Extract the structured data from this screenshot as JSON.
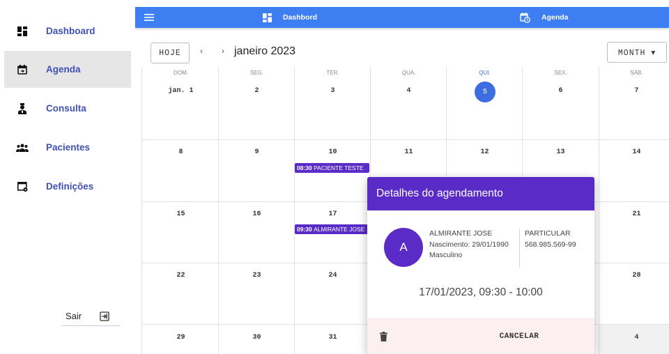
{
  "sidebar": {
    "items": [
      {
        "label": "Dashboard",
        "icon": "dashboard-icon"
      },
      {
        "label": "Agenda",
        "icon": "calendar-icon",
        "active": true
      },
      {
        "label": "Consulta",
        "icon": "doctor-icon"
      },
      {
        "label": "Pacientes",
        "icon": "people-icon"
      },
      {
        "label": "Definições",
        "icon": "settings-window-icon"
      }
    ],
    "logout_label": "Sair"
  },
  "header": {
    "dashboard_label": "Dashbord",
    "agenda_label": "Agenda"
  },
  "toolbar": {
    "today_label": "HOJE",
    "prev_label": "‹",
    "next_label": "›",
    "month_title": "janeiro 2023",
    "view_label": "MONTH ▾"
  },
  "calendar": {
    "weekdays": [
      "DOM.",
      "SEG.",
      "TER.",
      "QUA.",
      "QUI.",
      "SEX.",
      "SÁB."
    ],
    "weeks": [
      [
        "jan. 1",
        "2",
        "3",
        "4",
        "5",
        "6",
        "7"
      ],
      [
        "8",
        "9",
        "10",
        "11",
        "12",
        "13",
        "14"
      ],
      [
        "15",
        "16",
        "17",
        "",
        "",
        "",
        "21"
      ],
      [
        "22",
        "23",
        "24",
        "",
        "",
        "",
        "28"
      ],
      [
        "29",
        "30",
        "31",
        "",
        "",
        "",
        "4"
      ]
    ],
    "today": "5",
    "events": [
      {
        "time": "08:30",
        "title": "PACIENTE TESTE"
      },
      {
        "time": "09:30",
        "title": "ALMIRANTE JOSE"
      }
    ]
  },
  "dialog": {
    "title": "Detalhes do agendamento",
    "avatar_letter": "A",
    "patient_name": "ALMIRANTE JOSE",
    "birth": "Nascimento: 29/01/1990",
    "gender": "Masculino",
    "plan": "PARTICULAR",
    "document": "568.985.569-99",
    "datetime": "17/01/2023, 09:30 - 10:00",
    "cancel_label": "CANCELAR"
  },
  "colors": {
    "primary": "#3d7ff2",
    "accent": "#5b2bc7",
    "nav_text": "#3f51b5",
    "today": "#3d6ee0"
  }
}
